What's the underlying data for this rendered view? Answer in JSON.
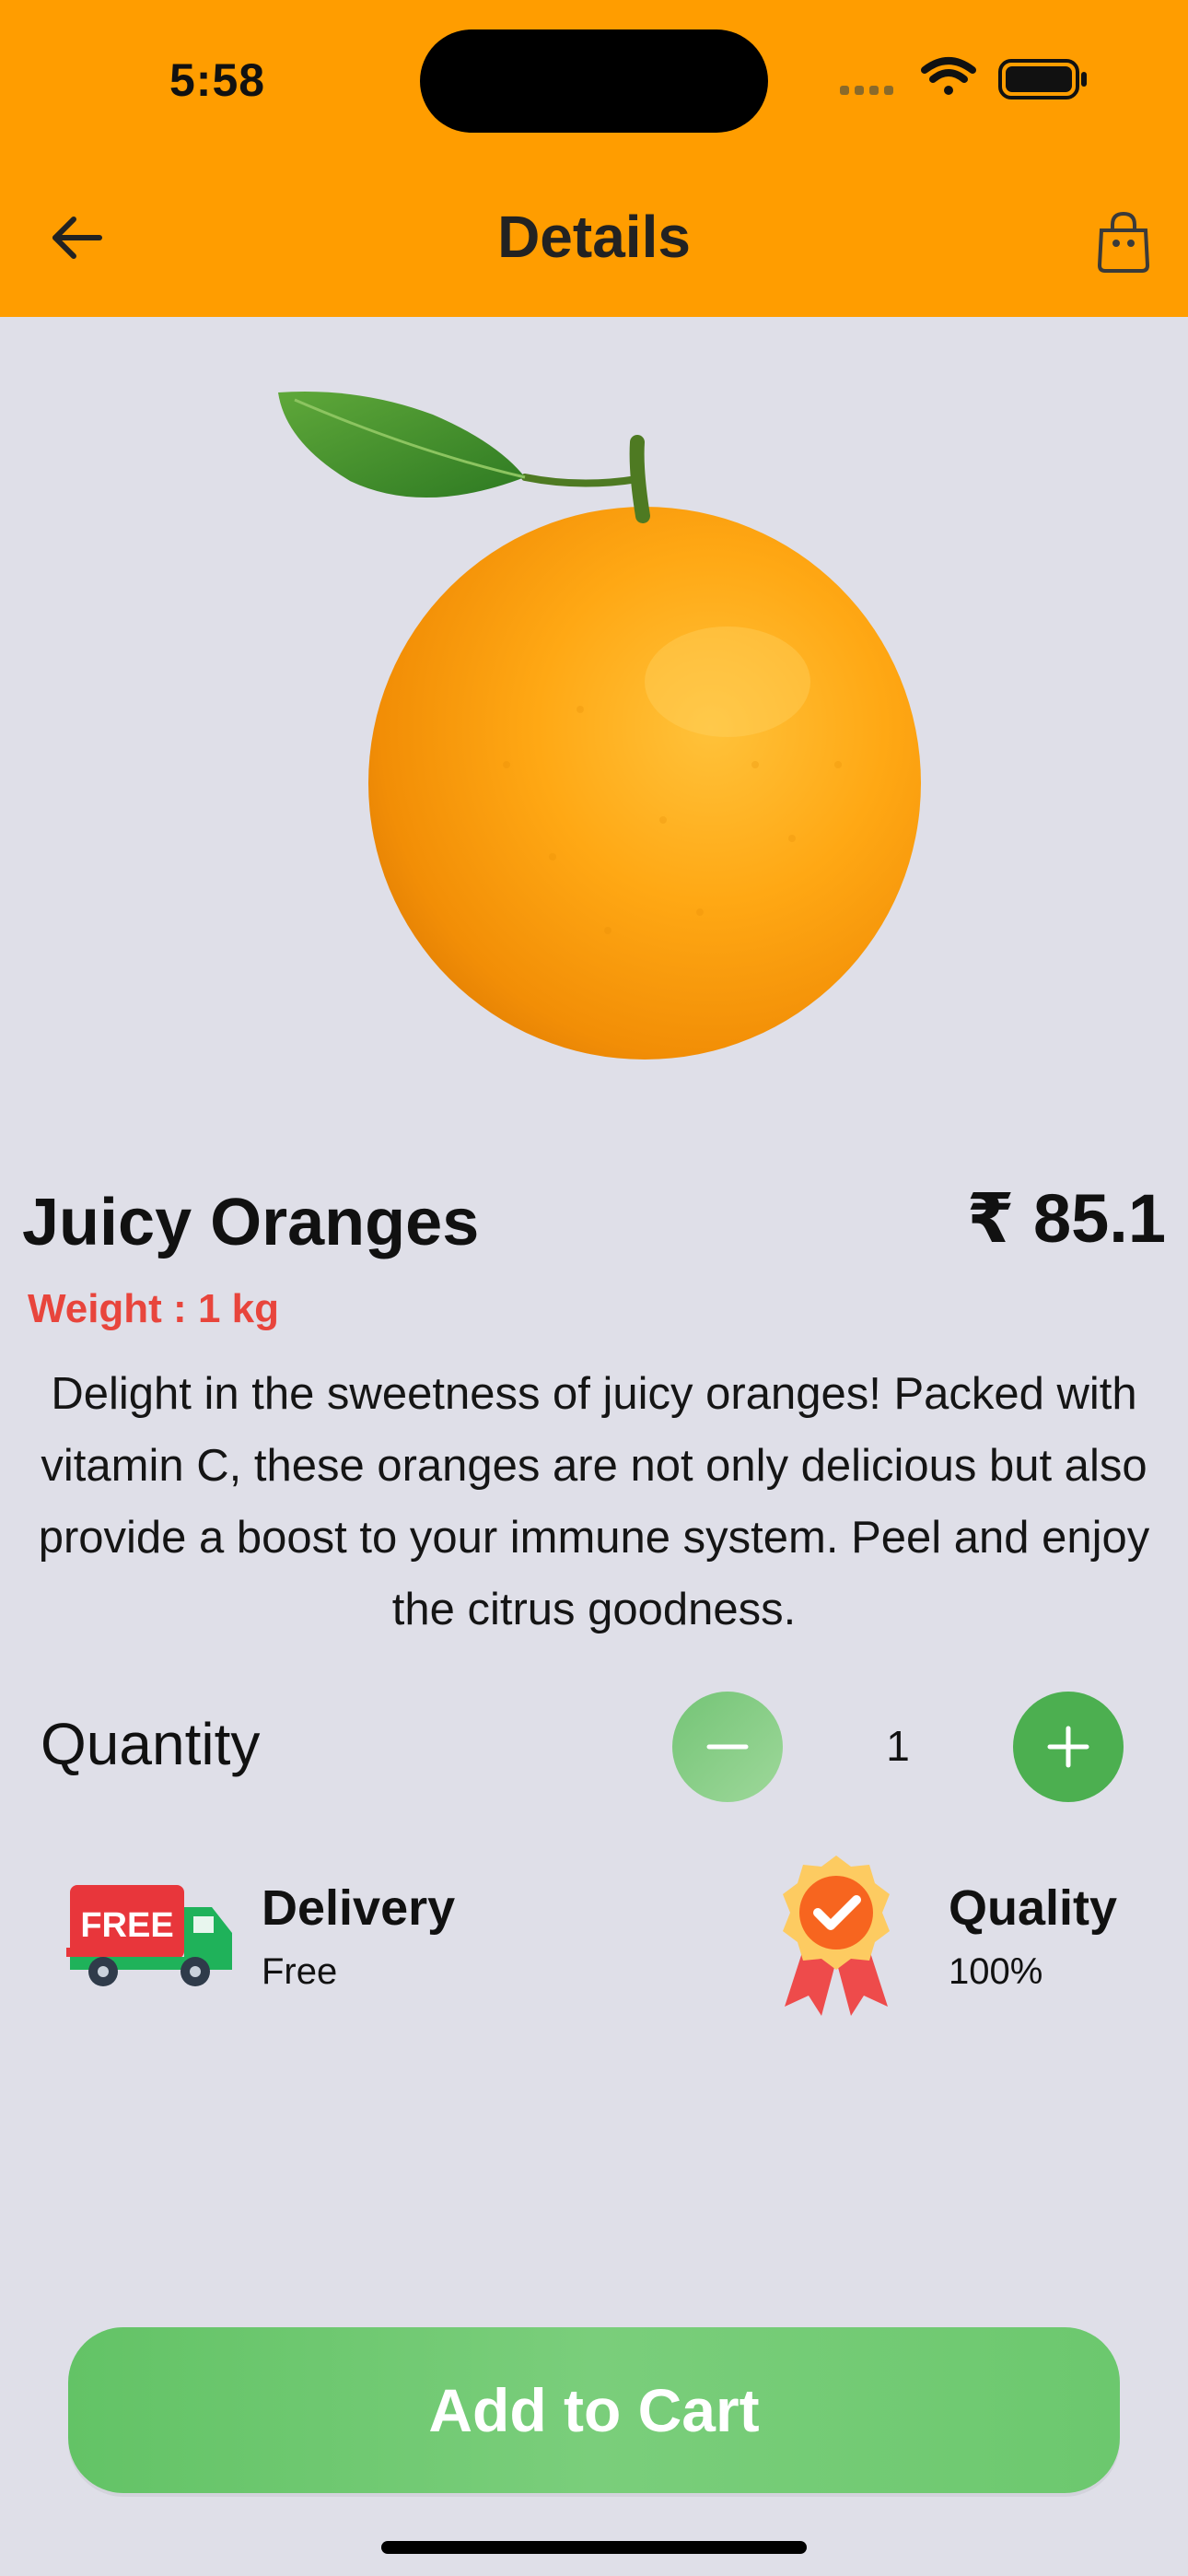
{
  "status_bar": {
    "time": "5:58",
    "icons": [
      "cellular-signal-icon",
      "wifi-icon",
      "battery-icon"
    ]
  },
  "header": {
    "title": "Details",
    "back_icon": "arrow-left-icon",
    "bag_icon": "shopping-bag-icon",
    "background": "#FF9D00"
  },
  "product": {
    "image": "orange-image",
    "name": "Juicy Oranges",
    "price": "₹ 85.1",
    "weight": "Weight : 1 kg",
    "description": "Delight in the sweetness of juicy oranges! Packed with vitamin C, these oranges are not only delicious but also provide a boost to your immune system. Peel and enjoy the citrus goodness."
  },
  "quantity": {
    "label": "Quantity",
    "value": "1",
    "decrement_icon": "minus-icon",
    "increment_icon": "plus-icon"
  },
  "features": [
    {
      "icon": "free-delivery-truck-icon",
      "badge_text": "FREE",
      "title": "Delivery",
      "subtitle": "Free"
    },
    {
      "icon": "quality-medal-icon",
      "title": "Quality",
      "subtitle": "100%"
    }
  ],
  "cta": {
    "label": "Add to Cart",
    "color": "#66C56A"
  },
  "colors": {
    "accent": "#FF9D00",
    "page_background": "#DFDFE8",
    "weight_text": "#E8453C",
    "green": "#4CAF50"
  }
}
